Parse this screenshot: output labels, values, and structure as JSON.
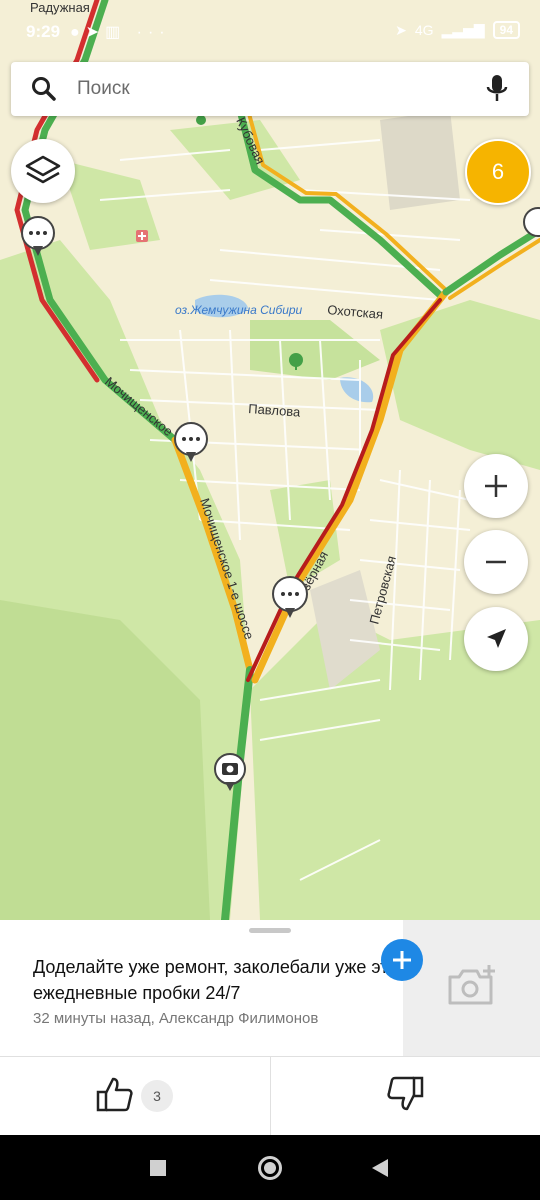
{
  "status_bar": {
    "time": "9:29",
    "battery": "94",
    "network": "4G"
  },
  "search": {
    "placeholder": "Поиск"
  },
  "map": {
    "streets": [
      "Кубовая",
      "Охотская",
      "Павлова",
      "Мочищенское 1-е шоссе",
      "Мочищенское",
      "Петровская",
      "Озёрная",
      "Радужная"
    ],
    "lake_label": "оз.Жемчужина Сибири",
    "traffic_level": "6"
  },
  "comment": {
    "text": "Доделайте уже ремонт, заколебали уже эти ежедневные пробки 24/7",
    "meta": "32 минуты назад, Александр Филимонов",
    "likes": "3"
  },
  "colors": {
    "accent": "#1e88e5",
    "traffic_badge": "#f6b400",
    "jam_red": "#d32f2f",
    "jam_yellow": "#f2b01e",
    "free_green": "#4caf50"
  },
  "icons": [
    "search-icon",
    "mic-icon",
    "layers-icon",
    "zoom-in-icon",
    "zoom-out-icon",
    "locate-icon",
    "camera-add-icon",
    "thumbs-up-icon",
    "thumbs-down-icon",
    "chat-bubble-icon",
    "camera-icon"
  ]
}
